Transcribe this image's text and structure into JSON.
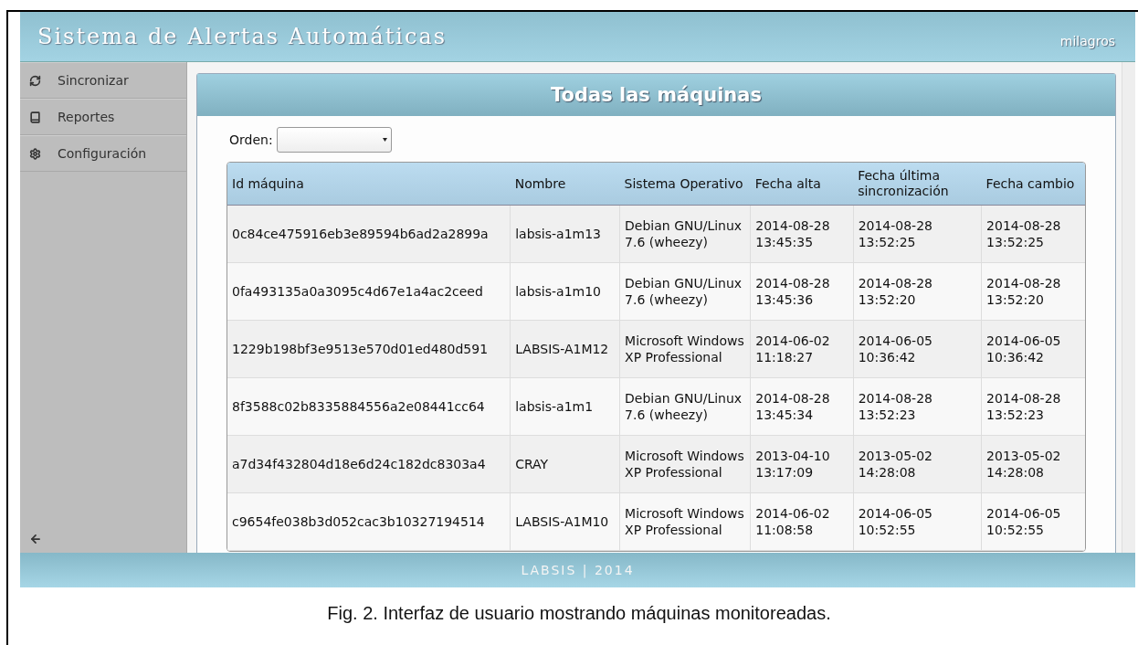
{
  "header": {
    "title": "Sistema de Alertas Automáticas",
    "user": "milagros"
  },
  "sidebar": {
    "items": [
      {
        "label": "Sincronizar",
        "kind": "sync"
      },
      {
        "label": "Reportes",
        "kind": "book"
      },
      {
        "label": "Configuración",
        "kind": "gear"
      }
    ]
  },
  "panel": {
    "title": "Todas las máquinas",
    "order_label": "Orden:"
  },
  "table": {
    "columns": [
      "Id máquina",
      "Nombre",
      "Sistema Operativo",
      "Fecha alta",
      "Fecha última sincronización",
      "Fecha cambio"
    ],
    "rows": [
      [
        "0c84ce475916eb3e89594b6ad2a2899a",
        "labsis-a1m13",
        "Debian GNU/Linux 7.6 (wheezy)",
        "2014-08-28 13:45:35",
        "2014-08-28 13:52:25",
        "2014-08-28 13:52:25"
      ],
      [
        "0fa493135a0a3095c4d67e1a4ac2ceed",
        "labsis-a1m10",
        "Debian GNU/Linux 7.6 (wheezy)",
        "2014-08-28 13:45:36",
        "2014-08-28 13:52:20",
        "2014-08-28 13:52:20"
      ],
      [
        "1229b198bf3e9513e570d01ed480d591",
        "LABSIS-A1M12",
        "Microsoft Windows XP Professional",
        "2014-06-02 11:18:27",
        "2014-06-05 10:36:42",
        "2014-06-05 10:36:42"
      ],
      [
        "8f3588c02b8335884556a2e08441cc64",
        "labsis-a1m1",
        "Debian GNU/Linux 7.6 (wheezy)",
        "2014-08-28 13:45:34",
        "2014-08-28 13:52:23",
        "2014-08-28 13:52:23"
      ],
      [
        "a7d34f432804d18e6d24c182dc8303a4",
        "CRAY",
        "Microsoft Windows XP Professional",
        "2013-04-10 13:17:09",
        "2013-05-02 14:28:08",
        "2013-05-02 14:28:08"
      ],
      [
        "c9654fe038b3d052cac3b10327194514",
        "LABSIS-A1M10",
        "Microsoft Windows XP Professional",
        "2014-06-02 11:08:58",
        "2014-06-05 10:52:55",
        "2014-06-05 10:52:55"
      ]
    ]
  },
  "footer": "LABSIS | 2014",
  "caption": "Fig. 2. Interfaz de usuario mostrando máquinas monitoreadas."
}
